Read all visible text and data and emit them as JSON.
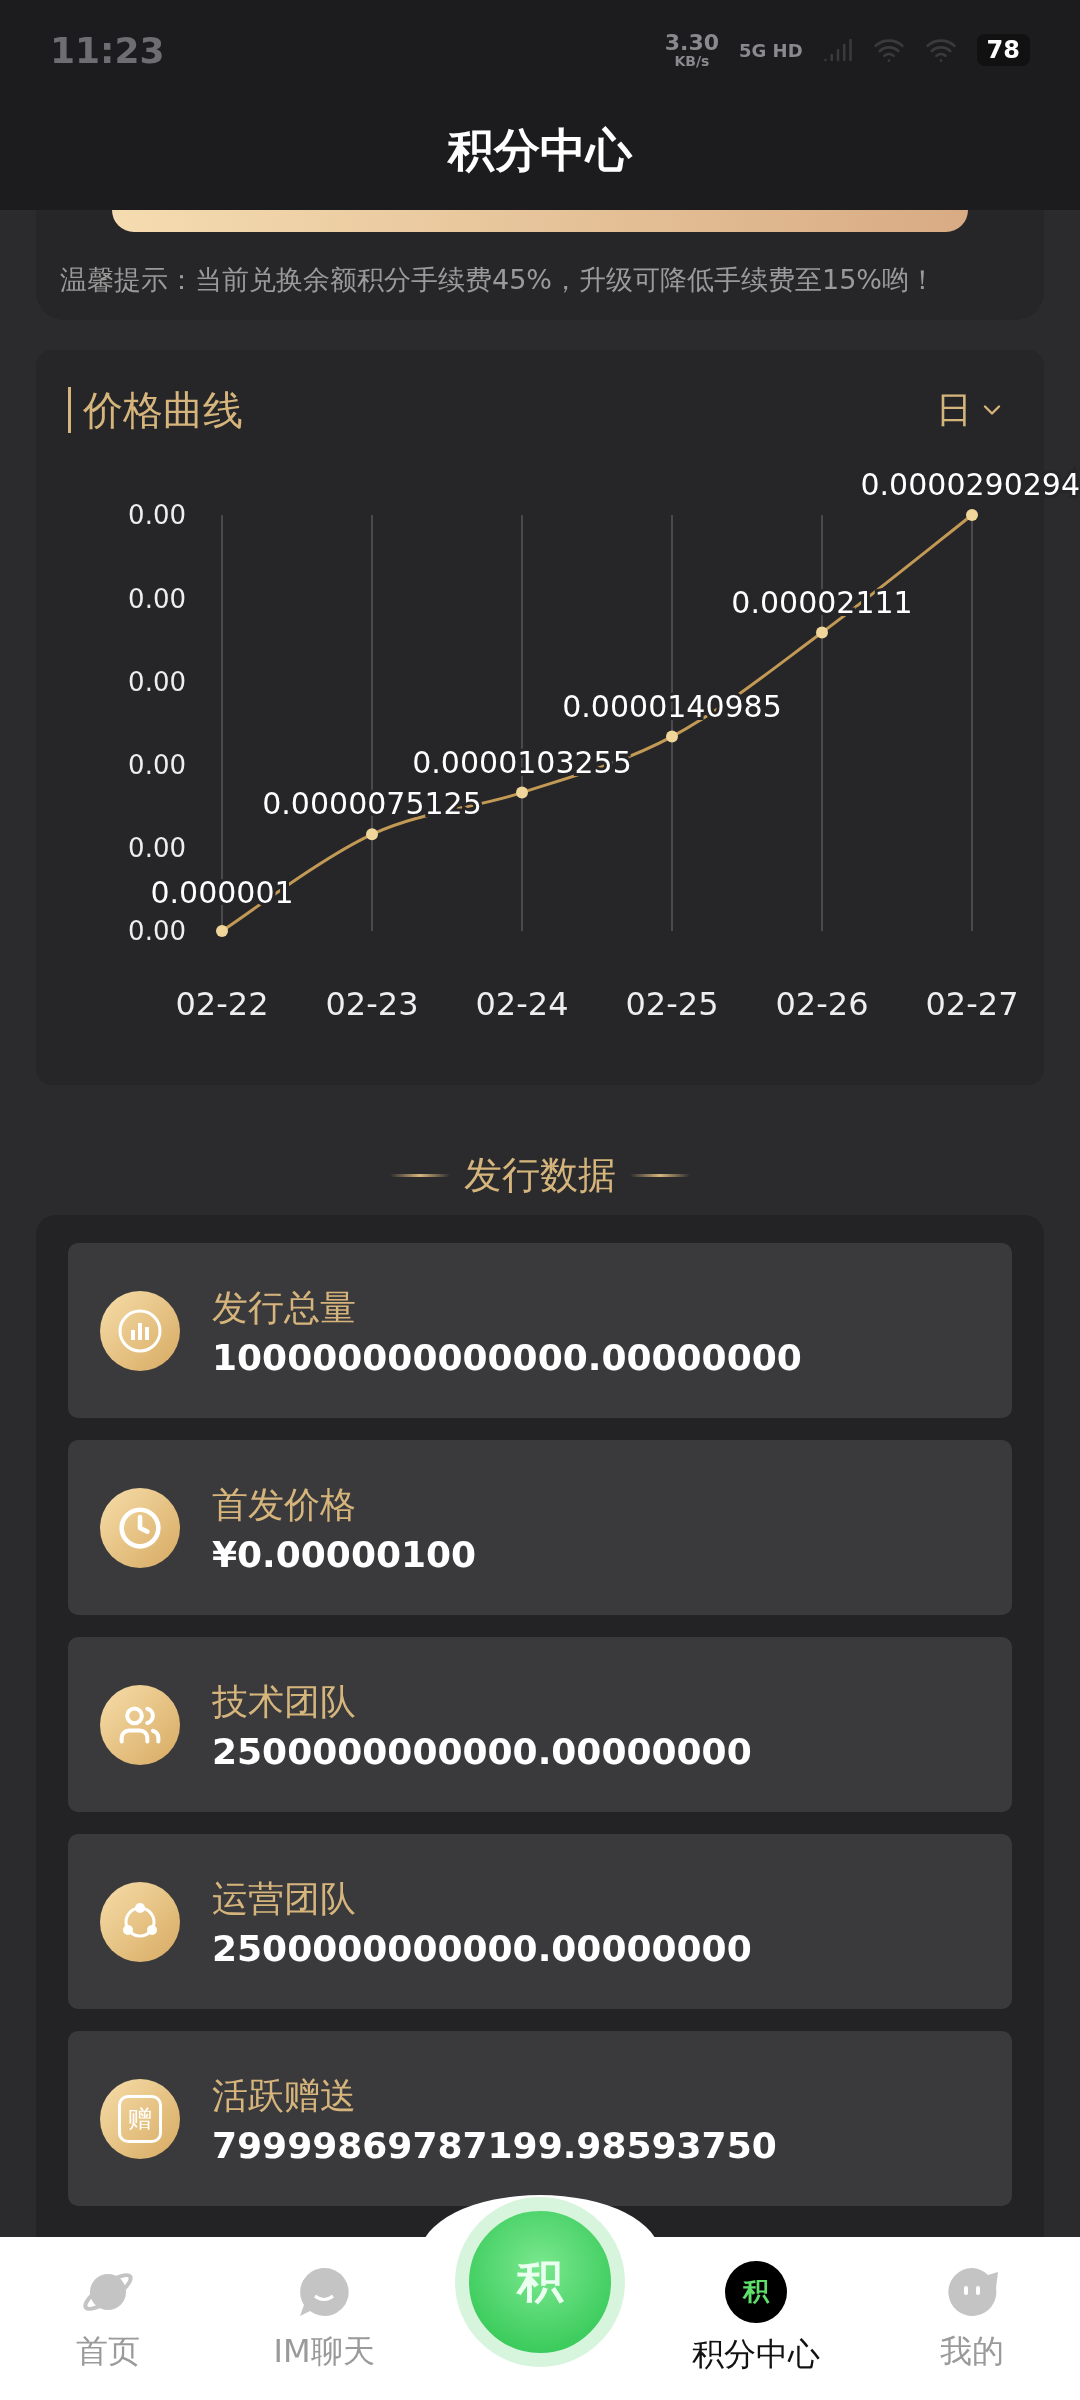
{
  "status_bar": {
    "time": "11:23",
    "network_speed": "3.30",
    "speed_unit": "KB/s",
    "network": "5G HD",
    "battery": "78"
  },
  "header": {
    "title": "积分中心"
  },
  "notice": {
    "text": "温馨提示：当前兑换余额积分手续费45%，升级可降低手续费至15%哟！"
  },
  "price_chart": {
    "title": "价格曲线",
    "period": "日",
    "chart_data": {
      "type": "line",
      "categories": [
        "02-22",
        "02-23",
        "02-24",
        "02-25",
        "02-26",
        "02-27"
      ],
      "grid": true,
      "series": [
        {
          "color": "#c39a55",
          "marker": true,
          "values": [
            1e-06,
            7.5125e-06,
            1.03255e-05,
            1.40985e-05,
            2.111e-05,
            2.90294e-05
          ]
        }
      ],
      "value_labels": [
        "0.000001",
        "0.0000075125",
        "0.0000103255",
        "0.0000140985",
        "0.00002111",
        "0.0000290294"
      ],
      "ylim": [
        1e-06,
        2.90294e-05
      ],
      "yticks": [
        {
          "value": 1e-06,
          "label": "0.00"
        },
        {
          "value": 6.6e-06,
          "label": "0.00"
        },
        {
          "value": 1.22e-05,
          "label": "0.00"
        },
        {
          "value": 1.78e-05,
          "label": "0.00"
        },
        {
          "value": 2.34e-05,
          "label": "0.00"
        },
        {
          "value": 2.90294e-05,
          "label": "0.00"
        }
      ]
    }
  },
  "issuance": {
    "title": "发行数据",
    "items": [
      {
        "kind": "chart",
        "label": "发行总量",
        "value": "100000000000000.00000000"
      },
      {
        "kind": "clock",
        "label": "首发价格",
        "value": "¥0.00000100"
      },
      {
        "kind": "team",
        "label": "技术团队",
        "value": "2500000000000.00000000"
      },
      {
        "kind": "network",
        "label": "运营团队",
        "value": "2500000000000.00000000"
      },
      {
        "kind": "gift",
        "label": "活跃赠送",
        "value": "79999869787199.98593750",
        "badge": "赠"
      }
    ]
  },
  "nav": {
    "center_badge": "积",
    "items": [
      {
        "kind": "planet",
        "label": "首页",
        "selected": false
      },
      {
        "kind": "chat",
        "label": "IM聊天",
        "selected": false
      },
      {
        "kind": "center"
      },
      {
        "kind": "points",
        "label": "积分中心",
        "selected": true,
        "badge": "积"
      },
      {
        "kind": "face",
        "label": "我的",
        "selected": false
      }
    ]
  }
}
